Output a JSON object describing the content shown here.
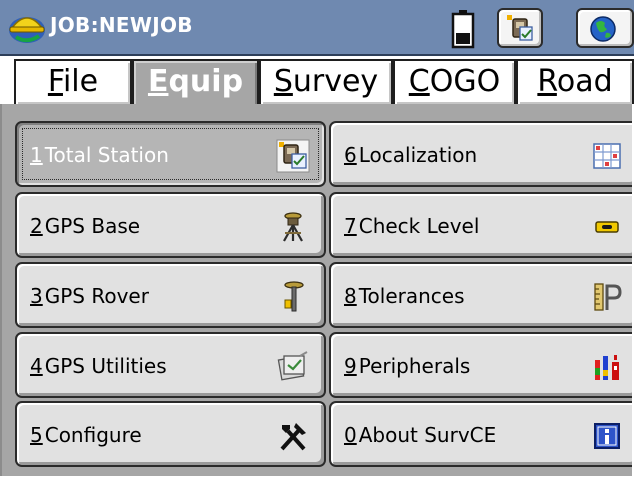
{
  "titlebar": {
    "app_icon": "hardhat-icon",
    "title": "JOB:NEWJOB",
    "battery_icon": "battery-icon",
    "instrument_button_icon": "total-station-icon",
    "globe_button_icon": "globe-icon"
  },
  "tabs": [
    {
      "label_prefix": "",
      "label_underlined": "F",
      "label_rest": "ile",
      "selected": false
    },
    {
      "label_prefix": "",
      "label_underlined": "E",
      "label_rest": "quip",
      "selected": true
    },
    {
      "label_prefix": "",
      "label_underlined": "S",
      "label_rest": "urvey",
      "selected": false
    },
    {
      "label_prefix": "",
      "label_underlined": "C",
      "label_rest": "OGO",
      "selected": false
    },
    {
      "label_prefix": "",
      "label_underlined": "R",
      "label_rest": "oad",
      "selected": false
    }
  ],
  "menu": {
    "left": [
      {
        "num": "1",
        "label": "Total Station",
        "icon": "total-station-icon",
        "selected": true
      },
      {
        "num": "2",
        "label": "GPS Base",
        "icon": "gps-base-icon",
        "selected": false
      },
      {
        "num": "3",
        "label": "GPS Rover",
        "icon": "gps-rover-icon",
        "selected": false
      },
      {
        "num": "4",
        "label": "GPS Utilities",
        "icon": "gps-utilities-icon",
        "selected": false
      },
      {
        "num": "5",
        "label": "Configure",
        "icon": "tools-icon",
        "selected": false
      }
    ],
    "right": [
      {
        "num": "6",
        "label": "Localization",
        "icon": "localization-grid-icon",
        "selected": false
      },
      {
        "num": "7",
        "label": "Check Level",
        "icon": "level-icon",
        "selected": false
      },
      {
        "num": "8",
        "label": "Tolerances",
        "icon": "tolerances-icon",
        "selected": false
      },
      {
        "num": "9",
        "label": "Peripherals",
        "icon": "peripherals-icon",
        "selected": false
      },
      {
        "num": "0",
        "label": "About SurvCE",
        "icon": "info-icon",
        "selected": false
      }
    ]
  },
  "colors": {
    "titlebar_bg": "#6f89b0",
    "panel_bg": "#a6a6a6",
    "button_face": "#e1e1e1",
    "selected_button_face": "#b5b5b5"
  }
}
